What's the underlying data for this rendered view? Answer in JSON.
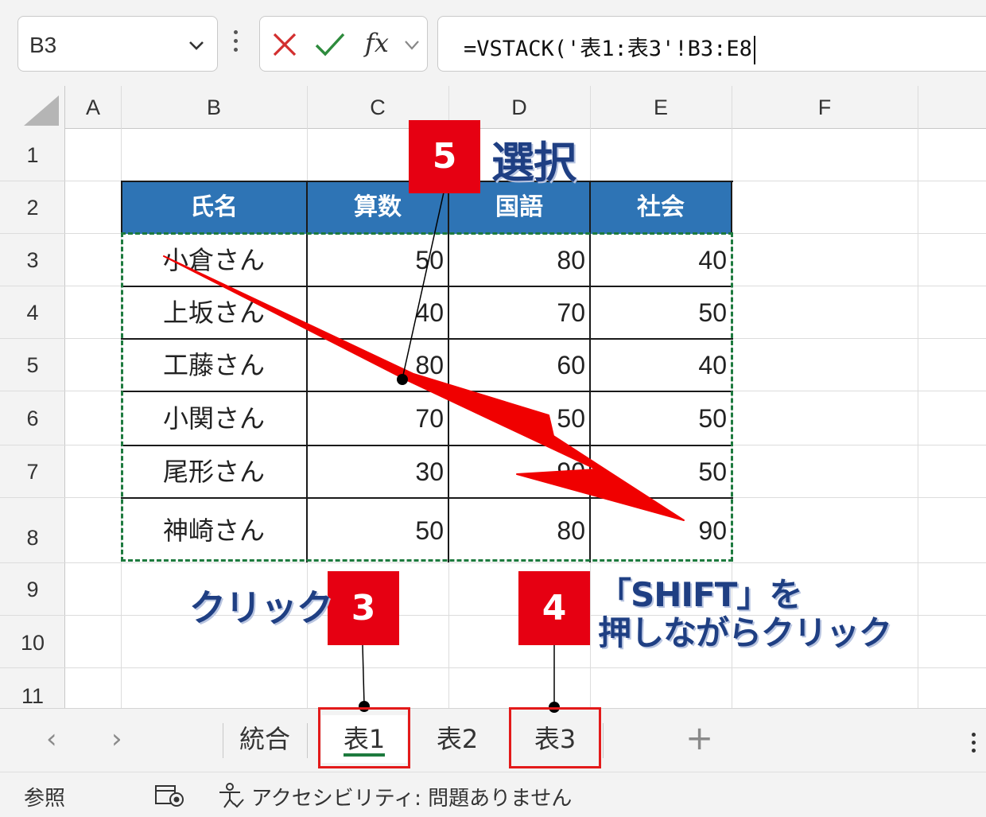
{
  "formula_bar": {
    "name_box": "B3",
    "fx_label": "fx",
    "formula": "=VSTACK('表1:表3'!B3:E8"
  },
  "columns": [
    "A",
    "B",
    "C",
    "D",
    "E",
    "F"
  ],
  "rows": [
    "1",
    "2",
    "3",
    "4",
    "5",
    "6",
    "7",
    "8",
    "9",
    "10",
    "11"
  ],
  "table": {
    "headers": [
      "氏名",
      "算数",
      "国語",
      "社会"
    ],
    "rows": [
      {
        "name": "小倉さん",
        "math": "50",
        "japanese": "80",
        "social": "40"
      },
      {
        "name": "上坂さん",
        "math": "40",
        "japanese": "70",
        "social": "50"
      },
      {
        "name": "工藤さん",
        "math": "80",
        "japanese": "60",
        "social": "40"
      },
      {
        "name": "小関さん",
        "math": "70",
        "japanese": "50",
        "social": "50"
      },
      {
        "name": "尾形さん",
        "math": "30",
        "japanese": "90",
        "social": "50"
      },
      {
        "name": "神崎さん",
        "math": "50",
        "japanese": "80",
        "social": "90"
      }
    ]
  },
  "sheet_tabs": [
    "統合",
    "表1",
    "表2",
    "表3"
  ],
  "active_tab": "表1",
  "status": {
    "mode": "参照",
    "accessibility": "アクセシビリティ: 問題ありません"
  },
  "annotations": {
    "step3": "3",
    "step4": "4",
    "step5": "5",
    "label_select": "選択",
    "label_click": "クリック",
    "label_shift_line1": "「SHIFT」を",
    "label_shift_line2": "押しながらクリック"
  },
  "colors": {
    "header_fill": "#2e74b5",
    "badge_red": "#e60012",
    "callout_navy": "#1f3f83",
    "selection_green": "#1d7a3e"
  }
}
